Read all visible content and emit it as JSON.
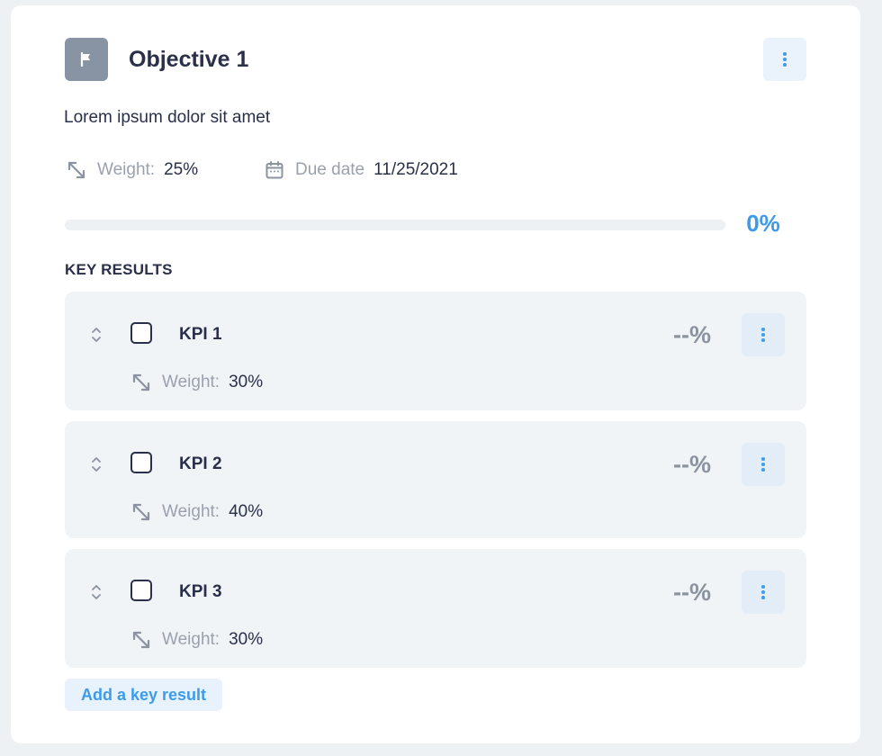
{
  "objective": {
    "title": "Objective 1",
    "icon": "flag-icon",
    "description": "Lorem ipsum dolor sit amet",
    "weight_label": "Weight:",
    "weight_value": "25%",
    "due_label": "Due date",
    "due_value": "11/25/2021",
    "progress": 0,
    "progress_text": "0%"
  },
  "key_results": {
    "section_title": "KEY RESULTS",
    "items": [
      {
        "name": "KPI 1",
        "percent": "--%",
        "weight_label": "Weight:",
        "weight_value": "30%"
      },
      {
        "name": "KPI 2",
        "percent": "--%",
        "weight_label": "Weight:",
        "weight_value": "40%"
      },
      {
        "name": "KPI 3",
        "percent": "--%",
        "weight_label": "Weight:",
        "weight_value": "30%"
      }
    ],
    "add_label": "Add a key result"
  },
  "colors": {
    "accent": "#3d9be9",
    "text": "#2a2f4a",
    "muted": "#9aa1ad",
    "icon_box": "#8894a3"
  }
}
